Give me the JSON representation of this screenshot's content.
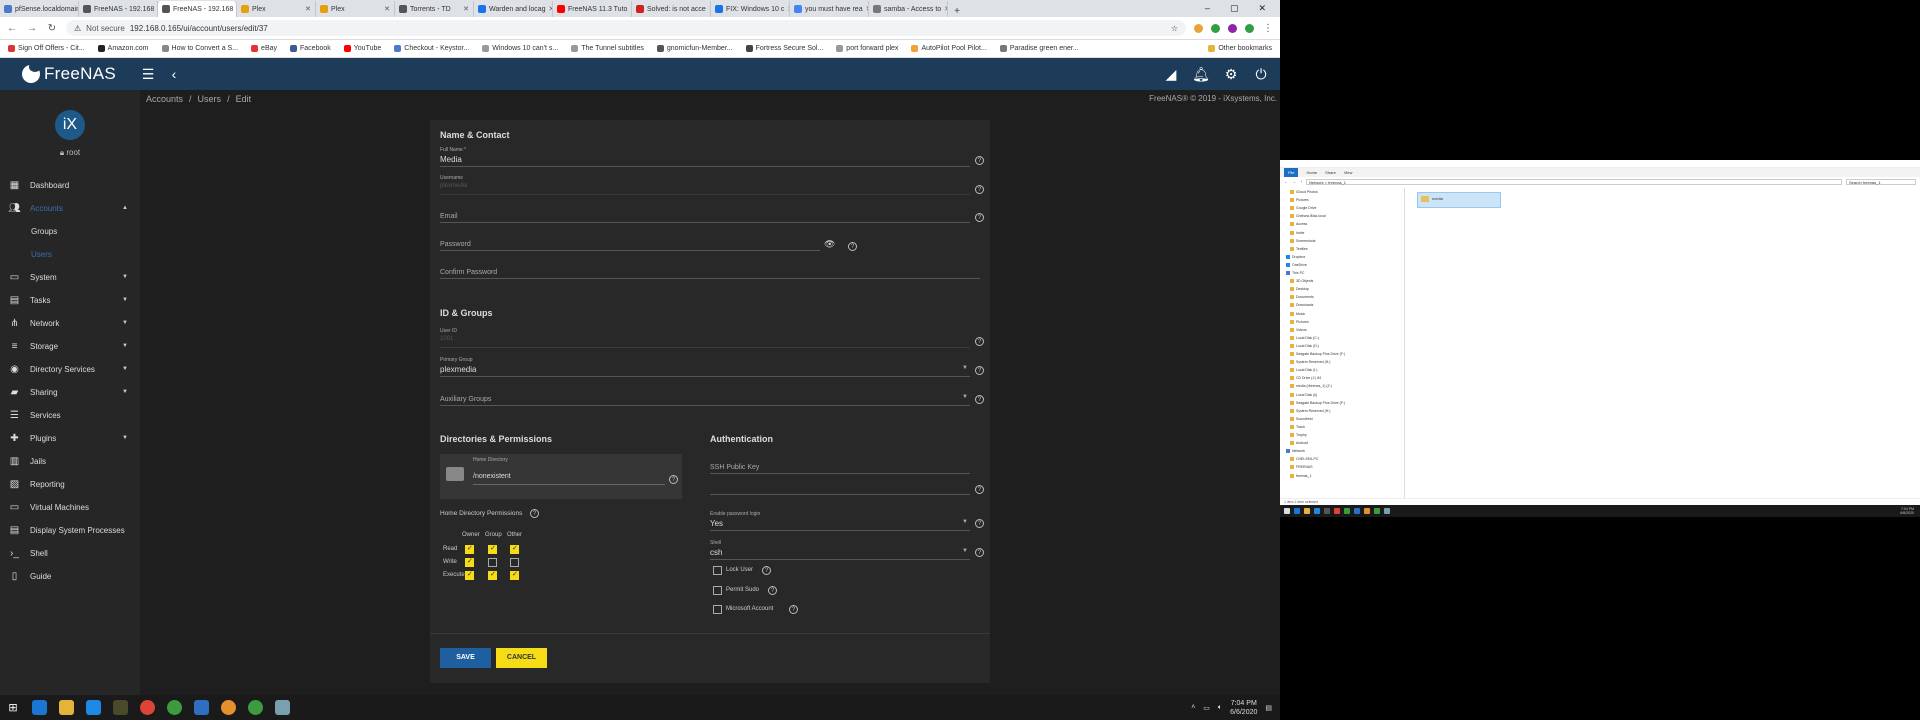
{
  "browser": {
    "tabs": [
      {
        "label": "pfSense.localdomain",
        "color": "#4a7bc8"
      },
      {
        "label": "FreeNAS - 192.168",
        "color": "#555555"
      },
      {
        "label": "FreeNAS - 192.168",
        "color": "#555555",
        "active": true
      },
      {
        "label": "Plex",
        "color": "#e5a00d"
      },
      {
        "label": "Plex",
        "color": "#e5a00d"
      },
      {
        "label": "Torrents - TD",
        "color": "#555555"
      },
      {
        "label": "Warden and locag",
        "color": "#1a73e8"
      },
      {
        "label": "FreeNAS 11.3 Tuto",
        "color": "#ff0000"
      },
      {
        "label": "Solved: is not acce",
        "color": "#cc2222"
      },
      {
        "label": "FIX: Windows 10 c",
        "color": "#1a73e8"
      },
      {
        "label": "you must have rea",
        "color": "#4285f4"
      },
      {
        "label": "samba - Access to",
        "color": "#777777"
      }
    ],
    "security": "Not secure",
    "url": "192.168.0.165/ui/account/users/edit/37"
  },
  "bookmarks": [
    "Sign Off Offers - Cit...",
    "Amazon.com",
    "How to Convert a S...",
    "eBay",
    "Facebook",
    "YouTube",
    "Checkout - Keystor...",
    "Windows 10 can't s...",
    "The Tunnel subtitles",
    "gnomicfun-Member...",
    "Fortress Secure Sol...",
    "port forward plex",
    "AutoPilot Pool Pilot...",
    "Paradise green ener..."
  ],
  "other_bookmarks": "Other bookmarks",
  "app": {
    "name": "FreeNAS",
    "ix": "iX",
    "user": "root",
    "breadcrumb": [
      "Accounts",
      "Users",
      "Edit"
    ],
    "copyright": "FreeNAS® © 2019 - iXsystems, Inc."
  },
  "sidebar": {
    "items": [
      {
        "label": "Dashboard",
        "icon": "dashboard-icon"
      },
      {
        "label": "Accounts",
        "icon": "people-icon",
        "expanded": true
      },
      {
        "label": "Groups",
        "sub": true
      },
      {
        "label": "Users",
        "sub": true,
        "selected": true
      },
      {
        "label": "System",
        "icon": "computer-icon"
      },
      {
        "label": "Tasks",
        "icon": "calendar-icon"
      },
      {
        "label": "Network",
        "icon": "network-icon"
      },
      {
        "label": "Storage",
        "icon": "storage-icon"
      },
      {
        "label": "Directory Services",
        "icon": "directory-icon"
      },
      {
        "label": "Sharing",
        "icon": "folder-icon"
      },
      {
        "label": "Services",
        "icon": "tune-icon"
      },
      {
        "label": "Plugins",
        "icon": "puzzle-icon"
      },
      {
        "label": "Jails",
        "icon": "jail-icon"
      },
      {
        "label": "Reporting",
        "icon": "chart-icon"
      },
      {
        "label": "Virtual Machines",
        "icon": "monitor-icon"
      },
      {
        "label": "Display System Processes",
        "icon": "list-icon"
      },
      {
        "label": "Shell",
        "icon": "terminal-icon"
      },
      {
        "label": "Guide",
        "icon": "book-icon"
      }
    ]
  },
  "form": {
    "section_name": "Name & Contact",
    "fullname_label": "Full Name *",
    "fullname_value": "Media",
    "username_label": "Username",
    "username_value": "plexmedia",
    "email_label": "Email",
    "password_label": "Password",
    "confirm_label": "Confirm Password",
    "section_id": "ID & Groups",
    "userid_label": "User ID",
    "userid_value": "1001",
    "primary_label": "Primary Group",
    "primary_value": "plexmedia",
    "aux_label": "Auxiliary Groups",
    "section_dirs": "Directories & Permissions",
    "homedir_label": "Home Directory",
    "homedir_value": "/nonexistent",
    "perms_label": "Home Directory Permissions",
    "perm_cols": [
      "Owner",
      "Group",
      "Other"
    ],
    "perm_rows": [
      {
        "label": "Read",
        "vals": [
          true,
          true,
          true
        ]
      },
      {
        "label": "Write",
        "vals": [
          true,
          false,
          false
        ]
      },
      {
        "label": "Execute",
        "vals": [
          true,
          true,
          true
        ]
      }
    ],
    "section_auth": "Authentication",
    "ssh_label": "SSH Public Key",
    "pwlogin_label": "Enable password login",
    "pwlogin_value": "Yes",
    "shell_label": "Shell",
    "shell_value": "csh",
    "lock_label": "Lock User",
    "sudo_label": "Permit Sudo",
    "ms_label": "Microsoft Account",
    "save": "SAVE",
    "cancel": "CANCEL"
  },
  "taskbar": {
    "time": "7:04 PM",
    "date": "6/6/2020"
  },
  "explorer": {
    "ribbon": [
      "File",
      "Home",
      "Share",
      "View"
    ],
    "path": "Network > freenas_1",
    "search": "Search freenas_1",
    "tree": [
      "iCloud Photos",
      "Pictures",
      "Google Drive",
      "Chelsea-iMac.local",
      "Access",
      "Invite",
      "Screenshots",
      "Textiles",
      "Dropbox",
      "OneDrive",
      "This PC",
      "3D Objects",
      "Desktop",
      "Documents",
      "Downloads",
      "Music",
      "Pictures",
      "Videos",
      "Local Disk (C:)",
      "Local Disk (D:)",
      "Seagate Backup Plus Drive (F:)",
      "System Reserved (H:)",
      "Local Disk (I:)",
      "CD Drive (J:) 84",
      "media (\\freenas_1) (Z:)",
      "Local Disk (k)",
      "Seagate Backup Plus Drive (F:)",
      "System Reserved (H:)",
      "Soundfield",
      "Trash",
      "Trophy",
      "Android",
      "Network",
      "CHELSEA-PC",
      "FREENAS",
      "freenas_1"
    ],
    "item": "media",
    "status": "1 item   1 item selected"
  }
}
